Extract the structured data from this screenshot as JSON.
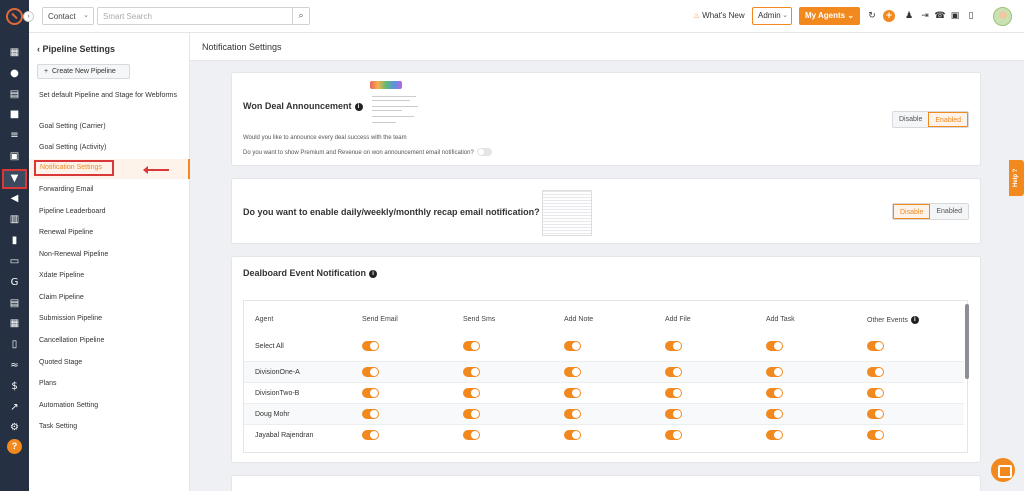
{
  "topbar": {
    "module_select": "Contact",
    "search_placeholder": "Smart Search",
    "whats_new": "What's New",
    "role_select": "Admin",
    "my_agents": "My Agents"
  },
  "sidebar": {
    "back_label": "Pipeline Settings",
    "create_button": "Create New Pipeline",
    "items": [
      "Set default Pipeline and Stage for Webforms",
      "Goal Setting (Carrier)",
      "Goal Setting (Activity)",
      "Notification Settings",
      "Forwarding Email",
      "Pipeline Leaderboard",
      "Renewal Pipeline",
      "Non-Renewal Pipeline",
      "Xdate Pipeline",
      "Claim Pipeline",
      "Submission Pipeline",
      "Cancellation Pipeline",
      "Quoted Stage",
      "Plans",
      "Automation Setting",
      "Task Setting"
    ],
    "active_item": "Notification Settings"
  },
  "main": {
    "header": "Notification Settings",
    "won_deal": {
      "title": "Won Deal Announcement",
      "q1": "Would you like to announce every deal success with the team",
      "q2": "Do you want to show Premium and Revenue on won announcement email notification?",
      "disable": "Disable",
      "enabled": "Enabled",
      "state": "Enabled"
    },
    "recap": {
      "title": "Do you want to enable daily/weekly/monthly recap email notification?",
      "disable": "Disable",
      "enabled": "Enabled",
      "state": "Disable"
    },
    "dealboard": {
      "title": "Dealboard Event Notification",
      "columns": [
        "Agent",
        "Send Email",
        "Send Sms",
        "Add Note",
        "Add File",
        "Add Task",
        "Other Events"
      ],
      "rows": [
        {
          "agent": "Select All",
          "toggles": [
            true,
            true,
            true,
            true,
            true,
            true
          ]
        },
        {
          "agent": "DivisionOne-A",
          "toggles": [
            true,
            true,
            true,
            true,
            true,
            true
          ]
        },
        {
          "agent": "DivisionTwo-B",
          "toggles": [
            true,
            true,
            true,
            true,
            true,
            true
          ]
        },
        {
          "agent": "Doug Mohr",
          "toggles": [
            true,
            true,
            true,
            true,
            true,
            true
          ]
        },
        {
          "agent": "Jayabal Rajendran",
          "toggles": [
            true,
            true,
            true,
            true,
            true,
            true
          ]
        }
      ]
    }
  },
  "help_tab": "Help",
  "colors": {
    "accent": "#f2891f",
    "rail": "#253142",
    "highlight": "#d93838"
  }
}
